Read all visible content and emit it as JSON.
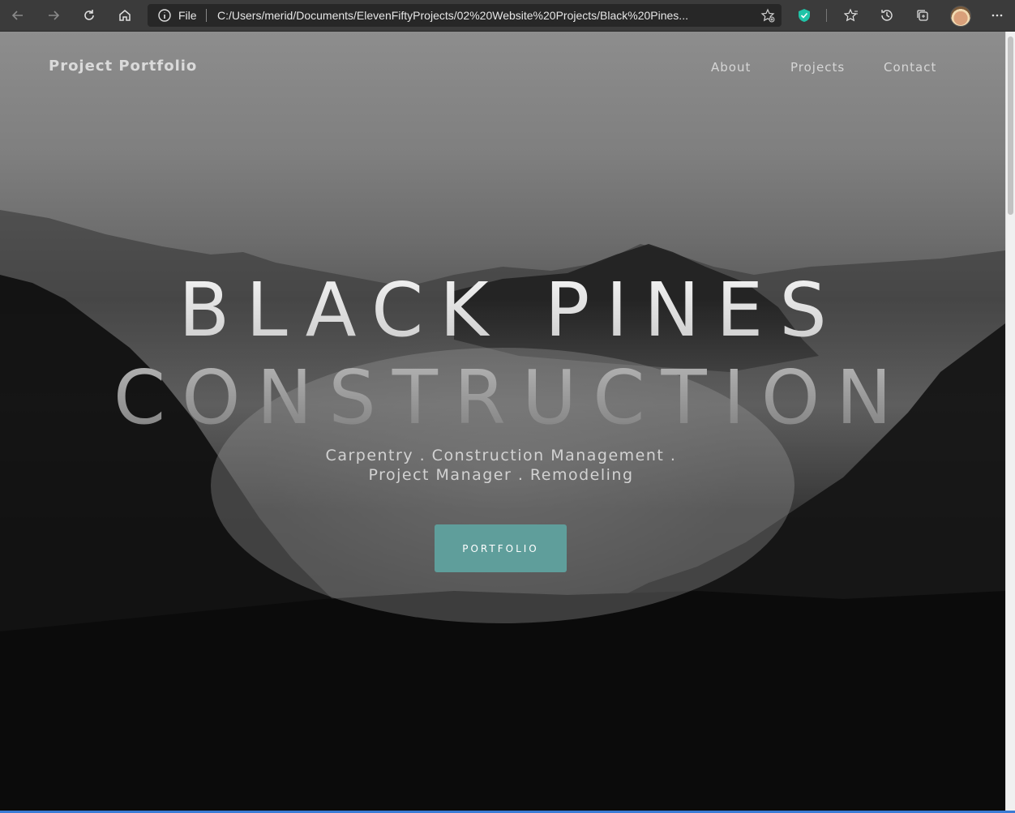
{
  "browser": {
    "address_prefix": "File",
    "url": "C:/Users/merid/Documents/ElevenFiftyProjects/02%20Website%20Projects/Black%20Pines..."
  },
  "nav": {
    "brand": "Project Portfolio",
    "links": [
      "About",
      "Projects",
      "Contact"
    ]
  },
  "hero": {
    "title_line1": "BLACK PINES",
    "title_line2": "CONSTRUCTION",
    "tagline": "Carpentry . Construction Management . Project Manager . Remodeling",
    "cta_label": "PORTFOLIO"
  },
  "colors": {
    "cta": "#5f9e9b",
    "chrome": "#3b3b3b"
  }
}
